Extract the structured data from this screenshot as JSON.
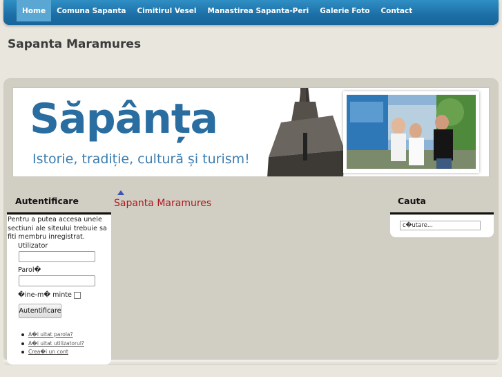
{
  "nav": {
    "items": [
      {
        "label": "Home",
        "active": true
      },
      {
        "label": "Comuna Sapanta",
        "active": false
      },
      {
        "label": "Cimitirul Vesel",
        "active": false
      },
      {
        "label": "Manastirea Sapanta-Peri",
        "active": false
      },
      {
        "label": "Galerie Foto",
        "active": false
      },
      {
        "label": "Contact",
        "active": false
      }
    ]
  },
  "site": {
    "title": "Sapanta Maramures"
  },
  "banner": {
    "title": "Săpânța",
    "tagline": "Istorie, tradiție, cultură și turism!"
  },
  "login": {
    "title": "Autentificare",
    "intro": "Pentru a putea accesa unele sectiuni ale siteului trebuie sa fiti membru inregistrat.",
    "username_label": "Utilizator",
    "password_label": "Parol�",
    "remember_label": "�ine-m� minte",
    "button_label": "Autentificare",
    "links": [
      "A�i uitat parola?",
      "A�i uitat utilizatorul?",
      "Crea�i un cont"
    ]
  },
  "main": {
    "article_title": "Sapanta Maramures"
  },
  "search": {
    "title": "Cauta",
    "value": "c�utare..."
  },
  "colors": {
    "nav": "#1c6fa6",
    "nav_active": "#5aa7d4",
    "accent_red": "#b01818",
    "banner_blue": "#2a6da0"
  }
}
